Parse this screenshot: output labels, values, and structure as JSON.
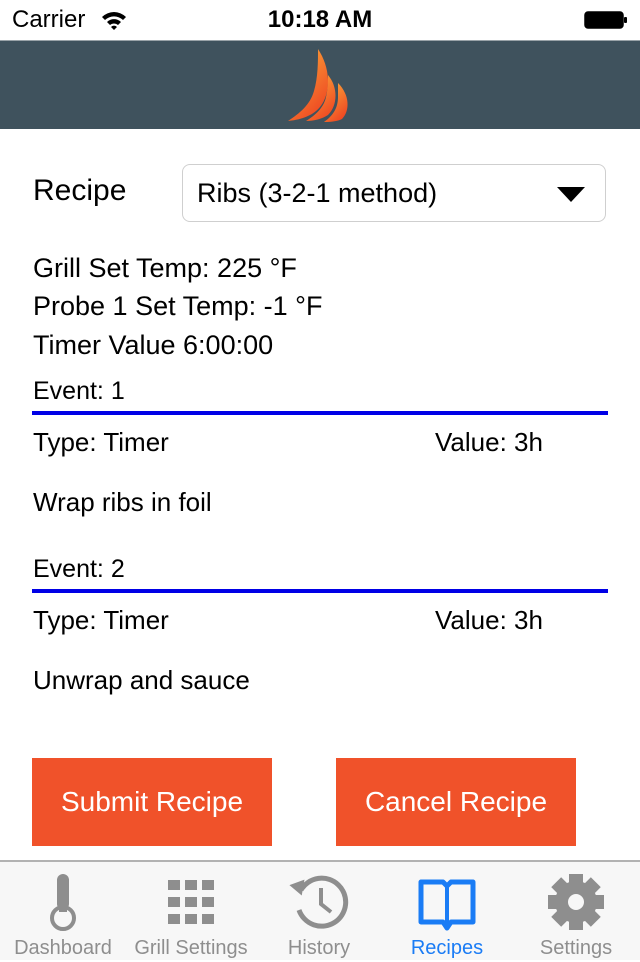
{
  "status_bar": {
    "carrier": "Carrier",
    "time": "10:18 AM"
  },
  "header": {
    "logo": "flame-logo"
  },
  "recipe": {
    "label": "Recipe",
    "selected": "Ribs (3-2-1 method)",
    "grill_set_temp": "Grill Set Temp: 225 °F",
    "probe1_set_temp": "Probe 1 Set Temp: -1 °F",
    "timer_value": "Timer Value 6:00:00"
  },
  "events": [
    {
      "title": "Event: 1",
      "type": "Type: Timer",
      "value": "Value: 3h",
      "description": "Wrap ribs in foil"
    },
    {
      "title": "Event: 2",
      "type": "Type: Timer",
      "value": "Value: 3h",
      "description": "Unwrap and sauce"
    }
  ],
  "buttons": {
    "submit": "Submit Recipe",
    "cancel": "Cancel Recipe"
  },
  "colors": {
    "nav": "#3f525d",
    "accent_button": "#f0522a",
    "event_line": "#0000e6",
    "tab_active": "#1a7cf5",
    "tab_inactive": "#8e8e8e"
  },
  "tabs": [
    {
      "label": "Dashboard",
      "icon": "thermometer-icon",
      "active": false
    },
    {
      "label": "Grill Settings",
      "icon": "grid-icon",
      "active": false
    },
    {
      "label": "History",
      "icon": "history-icon",
      "active": false
    },
    {
      "label": "Recipes",
      "icon": "book-icon",
      "active": true
    },
    {
      "label": "Settings",
      "icon": "gear-icon",
      "active": false
    }
  ]
}
